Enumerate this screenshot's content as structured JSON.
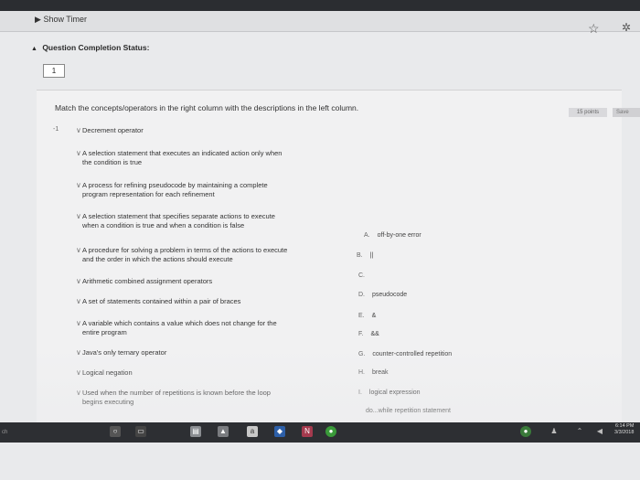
{
  "header": {
    "timer_link": "Show Timer"
  },
  "status": {
    "label": "Question Completion Status:",
    "question_number": "1"
  },
  "question": {
    "prompt": "Match the concepts/operators in the right column with the descriptions in the left column.",
    "points_label": "15 points",
    "save_label": "Save"
  },
  "rows": [
    {
      "sel": "-1",
      "text": "Decrement operator"
    },
    {
      "sel": "",
      "text": "A selection statement that executes an indicated action only when\nthe condition is true"
    },
    {
      "sel": "",
      "text": "A process for refining pseudocode by maintaining a complete\nprogram representation for each refinement"
    },
    {
      "sel": "",
      "text": "A selection statement that specifies separate actions to execute\nwhen a condition is true and when a condition is false"
    },
    {
      "sel": "",
      "text": "A procedure for solving a problem in terms of the actions to execute\nand the order in which the actions should execute"
    },
    {
      "sel": "",
      "text": "Arithmetic combined assignment operators"
    },
    {
      "sel": "",
      "text": "A set of statements contained within a pair of braces"
    },
    {
      "sel": "",
      "text": "A variable which contains a value which does not change for the\nentire program"
    },
    {
      "sel": "",
      "text": "Java's only ternary operator"
    },
    {
      "sel": "",
      "text": "Logical negation"
    },
    {
      "sel": "",
      "text": "Used when the number of repetitions is known before the loop\nbegins executing"
    }
  ],
  "answers": [
    {
      "letter": "A.",
      "text": "off-by-one error"
    },
    {
      "letter": "B.",
      "text": "||"
    },
    {
      "letter": "C.",
      "text": ""
    },
    {
      "letter": "D.",
      "text": "pseudocode"
    },
    {
      "letter": "E.",
      "text": "&"
    },
    {
      "letter": "F.",
      "text": "&&"
    },
    {
      "letter": "G.",
      "text": "counter-controlled repetition"
    },
    {
      "letter": "H.",
      "text": "break"
    },
    {
      "letter": "I.",
      "text": "logical expression"
    },
    {
      "letter": "",
      "text": "do...while repetition statement"
    }
  ],
  "taskbar": {
    "time": "6:14 PM",
    "date": "3/3/2018",
    "left_text": "ch"
  },
  "icons": {
    "star": "star-icon",
    "favorites": "favorites-icon"
  },
  "colors": {
    "page_bg": "#e9eaec",
    "taskbar": "#2d2f33"
  }
}
